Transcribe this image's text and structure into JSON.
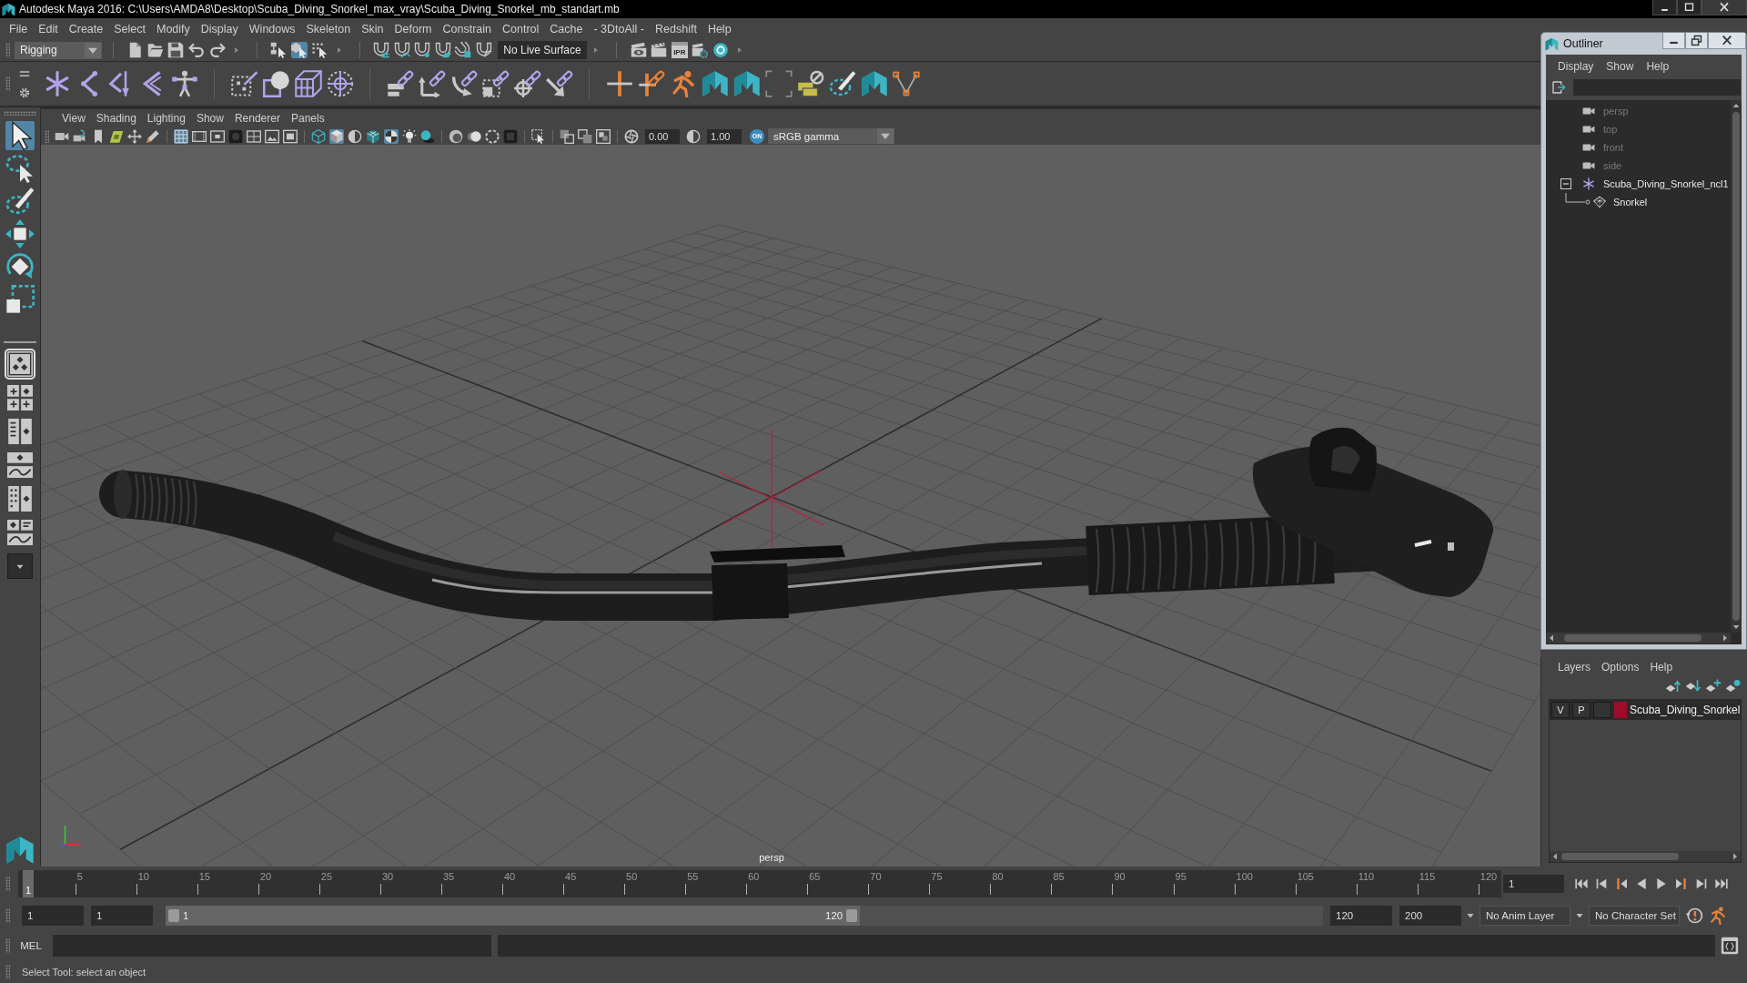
{
  "window": {
    "title": "Autodesk Maya 2016: C:\\Users\\AMDA8\\Desktop\\Scuba_Diving_Snorkel_max_vray\\Scuba_Diving_Snorkel_mb_standart.mb"
  },
  "menu_bar": [
    "File",
    "Edit",
    "Create",
    "Select",
    "Modify",
    "Display",
    "Windows",
    "Skeleton",
    "Skin",
    "Deform",
    "Constrain",
    "Control",
    "Cache",
    "- 3DtoAll -",
    "Redshift",
    "Help"
  ],
  "status_line": {
    "menu_set": "Rigging",
    "select_modes": [
      {
        "kind": "hierarchy",
        "selected": false
      },
      {
        "kind": "object",
        "selected": true
      },
      {
        "kind": "component",
        "selected": false
      }
    ],
    "live_surface": "No Live Surface",
    "ipr_button": "IPR"
  },
  "toolbox": {
    "tools": [
      {
        "kind": "select",
        "selected": true
      },
      {
        "kind": "lasso",
        "selected": false
      },
      {
        "kind": "paint",
        "selected": false
      },
      {
        "kind": "move",
        "selected": false
      },
      {
        "kind": "rotate",
        "selected": false
      },
      {
        "kind": "scale",
        "selected": false
      }
    ],
    "layouts": [
      {
        "kind": "single",
        "selected": true
      },
      {
        "kind": "quad",
        "selected": false
      },
      {
        "kind": "outliner-layout",
        "selected": false
      },
      {
        "kind": "graph-layout",
        "selected": false
      },
      {
        "kind": "channels-layout",
        "selected": false
      },
      {
        "kind": "split-layout",
        "selected": false
      }
    ]
  },
  "viewport": {
    "menu": [
      "View",
      "Shading",
      "Lighting",
      "Show",
      "Renderer",
      "Panels"
    ],
    "toolbar": [
      [
        {
          "kind": "camera",
          "selected": false
        },
        {
          "kind": "camera-attributes",
          "selected": false
        },
        {
          "kind": "bookmark",
          "selected": false
        },
        {
          "kind": "image-plane",
          "selected": false
        },
        {
          "kind": "pan",
          "selected": false
        },
        {
          "kind": "grease-pencil",
          "selected": false
        }
      ],
      [
        {
          "kind": "grid",
          "selected": true
        },
        {
          "kind": "film-gate",
          "selected": false
        },
        {
          "kind": "resolution-gate",
          "selected": false
        },
        {
          "kind": "gate-mask",
          "selected": false
        },
        {
          "kind": "field-chart",
          "selected": false
        },
        {
          "kind": "safe-action",
          "selected": false
        },
        {
          "kind": "safe-title",
          "selected": false
        }
      ],
      [
        {
          "kind": "wireframe",
          "selected": false
        },
        {
          "kind": "smooth-shade",
          "selected": true
        },
        {
          "kind": "default-material",
          "selected": false
        },
        {
          "kind": "wire-on-shaded",
          "selected": false
        },
        {
          "kind": "textured",
          "selected": true
        },
        {
          "kind": "lights",
          "selected": false
        },
        {
          "kind": "shadows",
          "selected": false
        }
      ],
      [
        {
          "kind": "ambient-occlusion",
          "selected": false
        },
        {
          "kind": "motion-blur",
          "selected": false
        },
        {
          "kind": "anti-aliasing",
          "selected": false
        },
        {
          "kind": "depth-of-field",
          "selected": false
        }
      ],
      [
        {
          "kind": "isolate",
          "selected": false
        }
      ],
      [
        {
          "kind": "xray",
          "selected": false
        },
        {
          "kind": "xray-joints",
          "selected": false
        },
        {
          "kind": "xray-components",
          "selected": false
        }
      ]
    ],
    "exposure": "0.00",
    "gamma": "1.00",
    "color_management": "ON",
    "view_transform": "sRGB gamma",
    "camera": "persp"
  },
  "outliner": {
    "title": "Outliner",
    "menu": [
      "Display",
      "Show",
      "Help"
    ],
    "items": [
      {
        "label": "persp",
        "kind": "camera",
        "hidden": true
      },
      {
        "label": "top",
        "kind": "camera",
        "hidden": true
      },
      {
        "label": "front",
        "kind": "camera",
        "hidden": true
      },
      {
        "label": "side",
        "kind": "camera",
        "hidden": true
      },
      {
        "label": "Scuba_Diving_Snorkel_ncl1",
        "kind": "group",
        "hidden": false,
        "expanded": true,
        "children": [
          {
            "label": "Snorkel",
            "kind": "mesh",
            "hidden": false
          }
        ]
      }
    ]
  },
  "layer_editor": {
    "menu": [
      "Layers",
      "Options",
      "Help"
    ],
    "layers": [
      {
        "visibility_toggle": "V",
        "playback_toggle": "P",
        "color": "#9e0b2b",
        "name": "Scuba_Diving_Snorkel"
      }
    ]
  },
  "time_slider": {
    "current_frame_marker": "1",
    "ticks": [
      "5",
      "10",
      "15",
      "20",
      "25",
      "30",
      "35",
      "40",
      "45",
      "50",
      "55",
      "60",
      "65",
      "70",
      "75",
      "80",
      "85",
      "90",
      "95",
      "100",
      "105",
      "110",
      "115",
      "120"
    ],
    "current_frame": "1"
  },
  "range_slider": {
    "animation_start": "1",
    "playback_start": "1",
    "range_start": "1",
    "range_end": "120",
    "level": 0.6,
    "playback_end": "120",
    "animation_end": "200",
    "anim_layer": "No Anim Layer",
    "character_set": "No Character Set"
  },
  "command_line": {
    "language": "MEL"
  },
  "help_line": "Select Tool: select an object"
}
